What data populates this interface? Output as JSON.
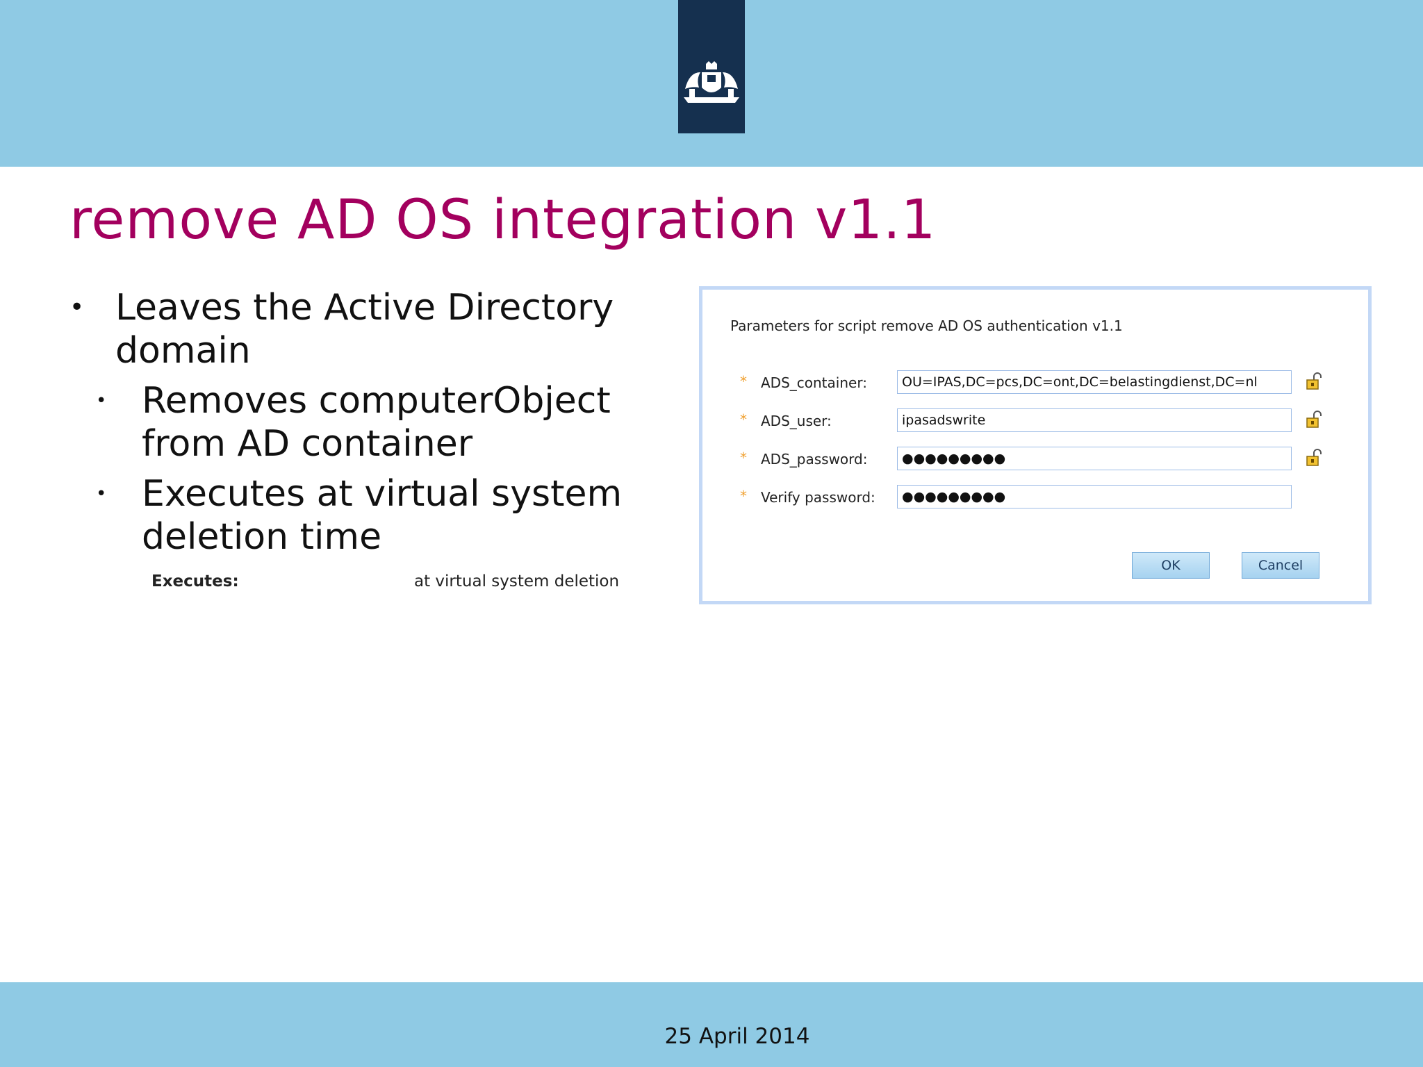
{
  "slide": {
    "title": "remove AD OS integration v1.1",
    "bullets": {
      "main": "Leaves the Active Directory domain",
      "sub1": "Removes computerObject from AD container",
      "sub2": "Executes at virtual system deletion time"
    },
    "executes": {
      "label": "Executes:",
      "value": "at virtual system deletion"
    },
    "footer_date": "25 April 2014"
  },
  "dialog": {
    "title": "Parameters for script remove AD OS authentication v1.1",
    "fields": [
      {
        "label": "ADS_container:",
        "value": "OU=IPAS,DC=pcs,DC=ont,DC=belastingdienst,DC=nl",
        "required_mark": "*"
      },
      {
        "label": "ADS_user:",
        "value": "ipasadswrite",
        "required_mark": "*"
      },
      {
        "label": "ADS_password:",
        "value": "●●●●●●●●●",
        "required_mark": "*"
      },
      {
        "label": "Verify password:",
        "value": "●●●●●●●●●",
        "required_mark": "*"
      }
    ],
    "ok_label": "OK",
    "cancel_label": "Cancel"
  },
  "colors": {
    "band": "#8fcae4",
    "logo_bg": "#15304f",
    "title": "#a3005e",
    "required": "#f0a030"
  },
  "icons": [
    "crest-logo-icon",
    "unlock-icon"
  ]
}
